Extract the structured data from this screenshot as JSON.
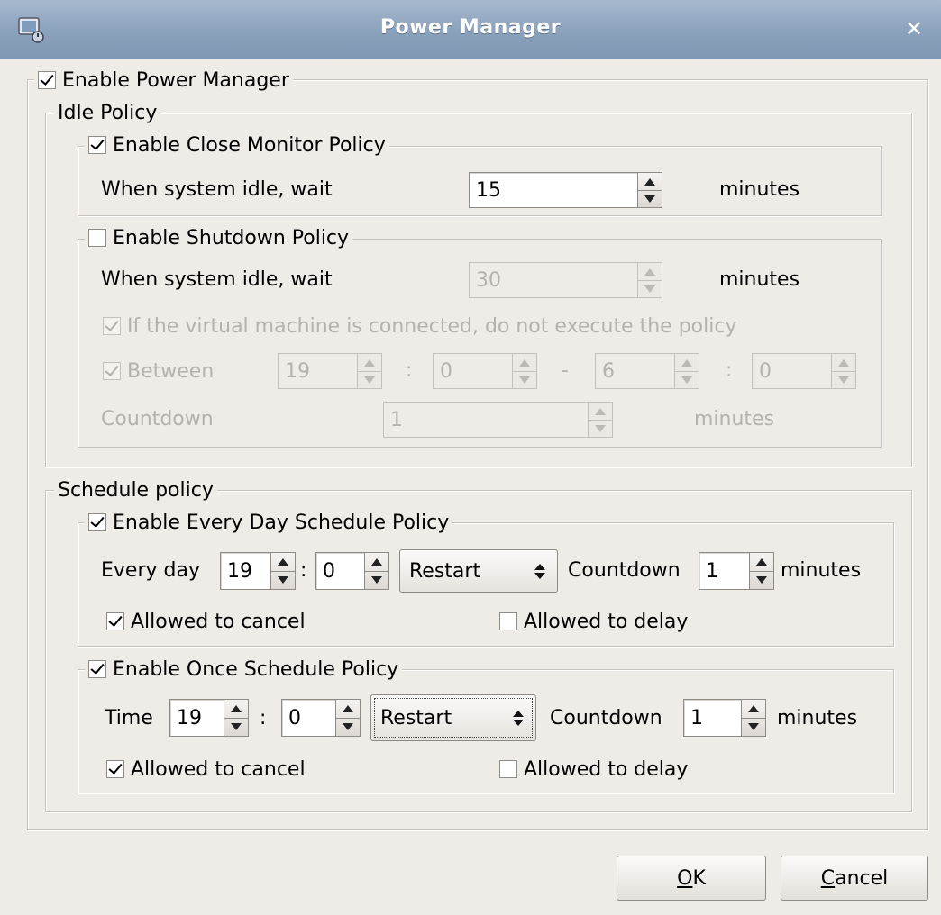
{
  "window": {
    "title": "Power Manager",
    "close_glyph": "✕",
    "app_icon": "power-manager-icon"
  },
  "enable_power_manager": {
    "label": "Enable Power Manager",
    "checked": true
  },
  "idle_policy": {
    "title": "Idle Policy",
    "close_monitor": {
      "label": "Enable Close Monitor Policy",
      "checked": true,
      "wait_label": "When system idle, wait",
      "wait_value": "15",
      "unit": "minutes"
    },
    "shutdown": {
      "label": "Enable Shutdown Policy",
      "checked": false,
      "wait_label": "When system idle, wait",
      "wait_value": "30",
      "unit": "minutes",
      "vm_label": "If the virtual machine is connected, do not execute the policy",
      "vm_checked": true,
      "between_label": "Between",
      "between_checked": true,
      "start_hour": "19",
      "colon1": ":",
      "start_min": "0",
      "dash": "-",
      "end_hour": "6",
      "colon2": ":",
      "end_min": "0",
      "countdown_label": "Countdown",
      "countdown_value": "1",
      "countdown_unit": "minutes"
    }
  },
  "schedule_policy": {
    "title": "Schedule policy",
    "every_day": {
      "label": "Enable Every Day Schedule Policy",
      "checked": true,
      "prefix": "Every day",
      "hour": "19",
      "colon": ":",
      "minute": "0",
      "action": "Restart",
      "countdown_label": "Countdown",
      "countdown_value": "1",
      "unit": "minutes",
      "allow_cancel_label": "Allowed to cancel",
      "allow_cancel": true,
      "allow_delay_label": "Allowed to delay",
      "allow_delay": false
    },
    "once": {
      "label": "Enable Once Schedule Policy",
      "checked": true,
      "prefix": "Time",
      "hour": "19",
      "colon": ":",
      "minute": "0",
      "action": "Restart",
      "countdown_label": "Countdown",
      "countdown_value": "1",
      "unit": "minutes",
      "allow_cancel_label": "Allowed to cancel",
      "allow_cancel": true,
      "allow_delay_label": "Allowed to delay",
      "allow_delay": false
    }
  },
  "buttons": {
    "ok_mnemonic": "O",
    "ok_rest": "K",
    "cancel_mnemonic": "C",
    "cancel_rest": "ancel"
  },
  "colors": {
    "titlebar": "#8aa1bb",
    "window_bg": "#efebe7",
    "disabled_text": "#b5b1ac"
  }
}
